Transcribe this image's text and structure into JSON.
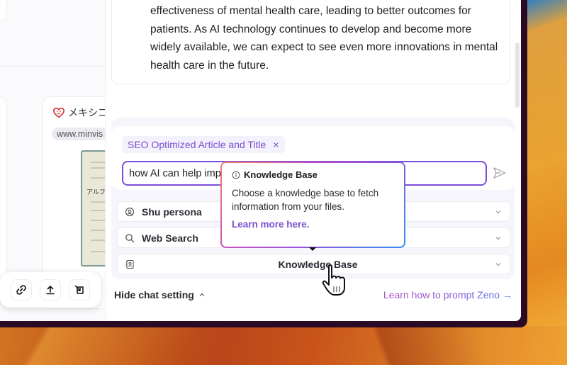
{
  "canvas": {
    "card": {
      "title": "メキシコ",
      "url": "www.minvis",
      "doc_text": "アルファ"
    },
    "toolbar": {
      "link_label": "link",
      "upload_label": "upload",
      "export_label": "export"
    }
  },
  "chat": {
    "answer_text": "effectiveness of mental health care, leading to better outcomes for patients. As AI technology continues to develop and become more widely available, we can expect to see even more innovations in mental health care in the future.",
    "composer": {
      "chip_label": "SEO Optimized Article and Title",
      "chip_close": "×",
      "input_value": "how AI can help improve mental health care"
    },
    "settings": [
      {
        "label": "Shu persona",
        "icon": "persona-icon"
      },
      {
        "label": "Web Search",
        "icon": "search-icon"
      },
      {
        "label": "Knowledge Base",
        "icon": "address-book-icon"
      }
    ],
    "footer": {
      "hide_label": "Hide chat setting",
      "learn_link": "Learn how to prompt Zeno →"
    }
  },
  "tooltip": {
    "title": "Knowledge Base",
    "body": "Choose a knowledge base to fetch information from your files.",
    "link": "Learn more here."
  },
  "colors": {
    "accent": "#7b4fd0",
    "input_border": "#7c4ddb"
  }
}
